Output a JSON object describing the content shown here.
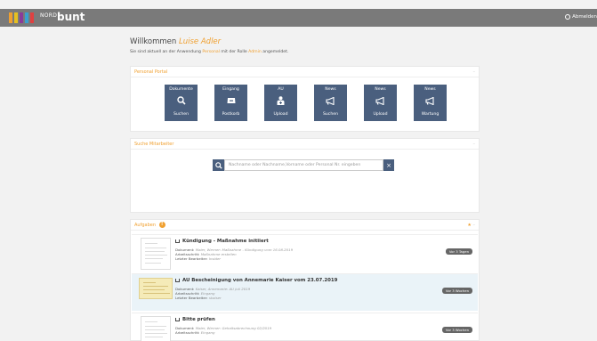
{
  "header": {
    "logo_nord": "NORD",
    "logo_bunt": "bunt",
    "logo_colors": [
      "#f0a030",
      "#e6c020",
      "#8a3a9a",
      "#3aa0d0",
      "#e04040"
    ],
    "logout_label": "Abmelden"
  },
  "welcome": {
    "prefix": "Willkommen",
    "name": "Luise Adler",
    "sub_pre": "Sie sind aktuell an der Anwendung",
    "sub_app": "Personal",
    "sub_mid": "mit der Rolle",
    "sub_role": "Admin",
    "sub_post": "angemeldet."
  },
  "portal": {
    "title": "Personal Portal",
    "tiles": [
      {
        "top": "Dokumente",
        "icon": "search-icon",
        "bottom": "Suchen"
      },
      {
        "top": "Eingang",
        "icon": "inbox-icon",
        "bottom": "Postkorb"
      },
      {
        "top": "AU",
        "icon": "medic-icon",
        "bottom": "Upload"
      },
      {
        "top": "News",
        "icon": "megaphone-icon",
        "bottom": "Suchen"
      },
      {
        "top": "News",
        "icon": "megaphone-icon",
        "bottom": "Upload"
      },
      {
        "top": "News",
        "icon": "megaphone-icon",
        "bottom": "Wartung"
      }
    ]
  },
  "search": {
    "title": "Suche Mitarbeiter",
    "placeholder": "Nachname oder Nachname,Vorname oder Personal Nr. eingeben",
    "clear": "×"
  },
  "tasks": {
    "title": "Aufgaben",
    "count": "!",
    "items": [
      {
        "title": "Kündigung - Maßnahme initiiert",
        "doc_label": "Dokument:",
        "doc": "Maier, Werner: Maßnahme - Kündigung vom 16.08.2019",
        "step_label": "Arbeitsschritt:",
        "step": "Maßnahme erstellen",
        "editor_label": "Letzter Bearbeiter:",
        "editor": "Insider",
        "age": "Vor 3 Tagen"
      },
      {
        "title": "AU Bescheinigung von Annemarie Kaiser vom 23.07.2019",
        "doc_label": "Dokument:",
        "doc": "Kaiser, Annemarie: AU Juli 2019",
        "step_label": "Arbeitsschritt:",
        "step": "Eingang",
        "editor_label": "Letzter Bearbeiter:",
        "editor": "skaiser",
        "age": "Vor 3 Wochen"
      },
      {
        "title": "Bitte prüfen",
        "doc_label": "Dokument:",
        "doc": "Maier, Werner: Gehaltsabrechnung 02/2019",
        "step_label": "Arbeitsschritt:",
        "step": "Eingang",
        "editor_label": "",
        "editor": "",
        "age": "Vor 3 Wochen"
      }
    ]
  }
}
